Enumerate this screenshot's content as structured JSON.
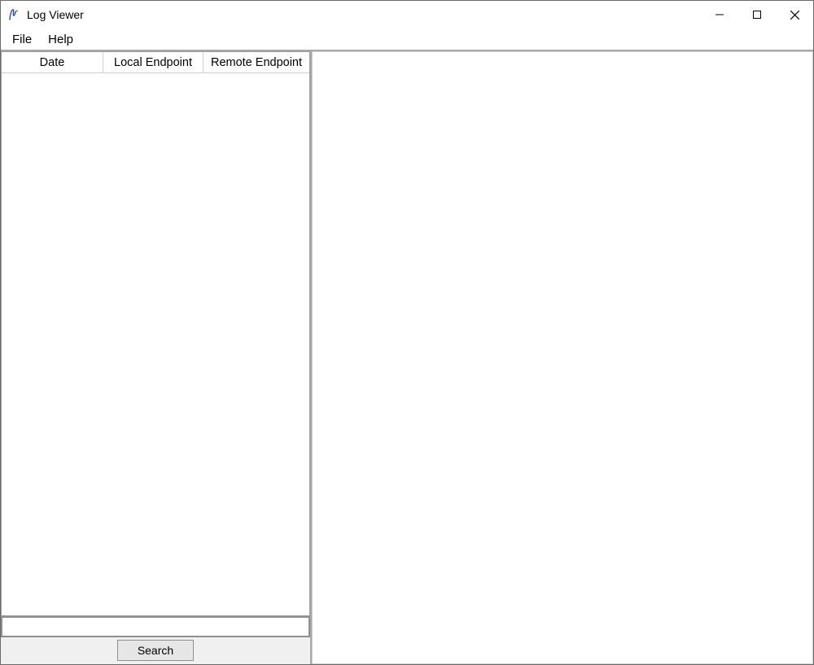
{
  "window": {
    "title": "Log Viewer"
  },
  "menu": {
    "file": "File",
    "help": "Help"
  },
  "columns": {
    "date": "Date",
    "local": "Local Endpoint",
    "remote": "Remote Endpoint"
  },
  "rows": [],
  "search": {
    "value": "",
    "button": "Search"
  }
}
